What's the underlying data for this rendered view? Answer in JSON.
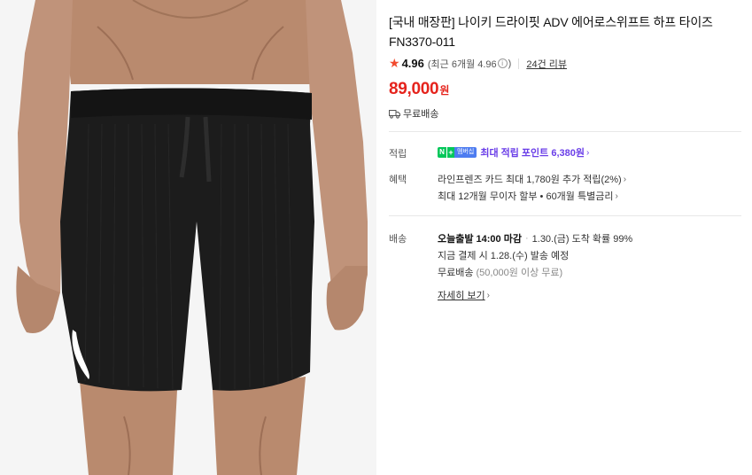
{
  "product": {
    "title_line1": "[국내 매장판] 나이키 드라이핏 ADV 에어로스위프트 하프 타이즈",
    "title_line2": "FN3370-011",
    "image_alt": "Nike Dri-FIT ADV AeroSwift half tights",
    "image_bg": "#f5f5f5"
  },
  "rating": {
    "star": "★",
    "score": "4.96",
    "recent_prefix": "(최근 6개월 4.96",
    "recent_suffix": ")",
    "info_icon": "i",
    "reviews": "24건 리뷰"
  },
  "price": {
    "amount": "89,000",
    "unit": "원",
    "color": "#e5231c"
  },
  "shipping_summary": {
    "icon": "truck-icon",
    "text": "무료배송"
  },
  "points": {
    "label": "적립",
    "badge_n": "N",
    "badge_plus": "+",
    "badge_member": "멤버십",
    "text": "최대 적립 포인트 6,380원",
    "chevron": "›",
    "color": "#6a3ee8"
  },
  "benefits": {
    "label": "혜택",
    "line1": "라인프렌즈 카드 최대 1,780원 추가 적립(2%)",
    "line2": "최대 12개월 무이자 할부 • 60개월 특별금리",
    "chevron": "›"
  },
  "delivery": {
    "label": "배송",
    "cutoff": "오늘출발 14:00 마감",
    "dot": "·",
    "arrival": "1.30.(금) 도착 확률 99%",
    "dispatch": "지금 결제 시 1.28.(수) 발송 예정",
    "free": "무료배송",
    "free_condition": "(50,000원 이상 무료)",
    "detail_link": "자세히 보기",
    "chevron": "›"
  }
}
